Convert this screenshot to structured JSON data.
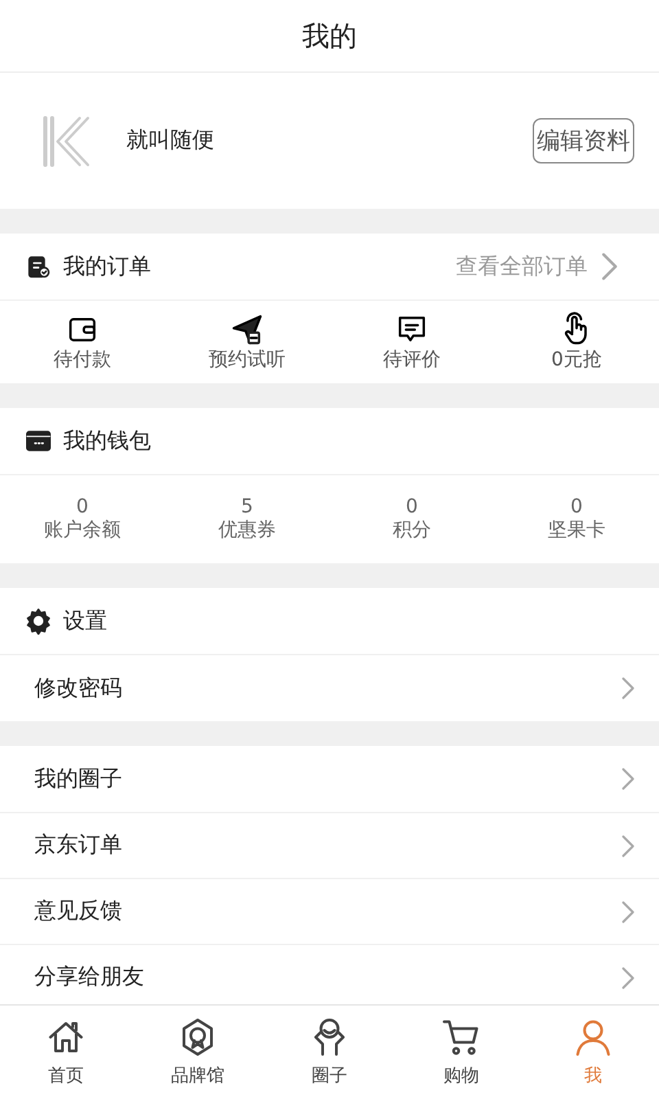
{
  "header": {
    "title": "我的"
  },
  "profile": {
    "name": "就叫随便",
    "edit_button": "编辑资料"
  },
  "orders": {
    "title": "我的订单",
    "view_all": "查看全部订单",
    "items": [
      {
        "kind": "wallet",
        "label": "待付款"
      },
      {
        "kind": "plane",
        "label": "预约试听"
      },
      {
        "kind": "comment",
        "label": "待评价"
      },
      {
        "kind": "hand",
        "label": "0元抢"
      }
    ]
  },
  "wallet": {
    "title": "我的钱包",
    "stats": [
      {
        "value": "0",
        "label": "账户余额"
      },
      {
        "value": "5",
        "label": "优惠券"
      },
      {
        "value": "0",
        "label": "积分"
      },
      {
        "value": "0",
        "label": "坚果卡"
      }
    ]
  },
  "settings": {
    "title": "设置",
    "items": [
      "修改密码"
    ]
  },
  "menu": [
    "我的圈子",
    "京东订单",
    "意见反馈",
    "分享给朋友"
  ],
  "tab_bar": [
    {
      "kind": "home",
      "label": "首页",
      "selected": false
    },
    {
      "kind": "badge",
      "label": "品牌馆",
      "selected": false
    },
    {
      "kind": "circle",
      "label": "圈子",
      "selected": false
    },
    {
      "kind": "cart",
      "label": "购物",
      "selected": false
    },
    {
      "kind": "person",
      "label": "我",
      "selected": true
    }
  ]
}
